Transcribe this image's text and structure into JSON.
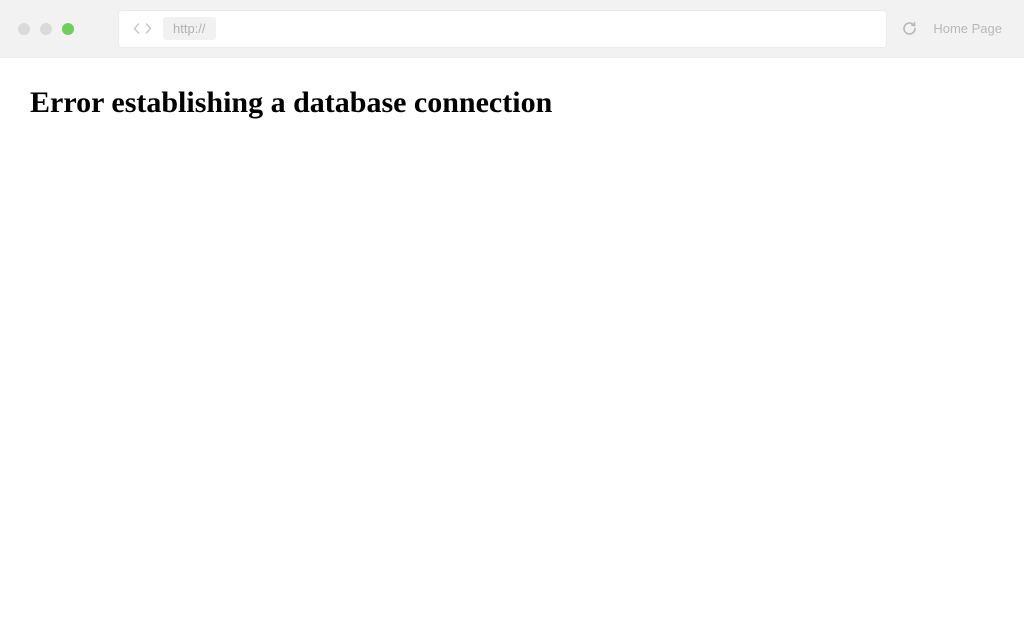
{
  "browser": {
    "url_prefix": "http://",
    "url_value": "",
    "home_label": "Home Page"
  },
  "page": {
    "error_heading": "Error establishing a database connection"
  }
}
